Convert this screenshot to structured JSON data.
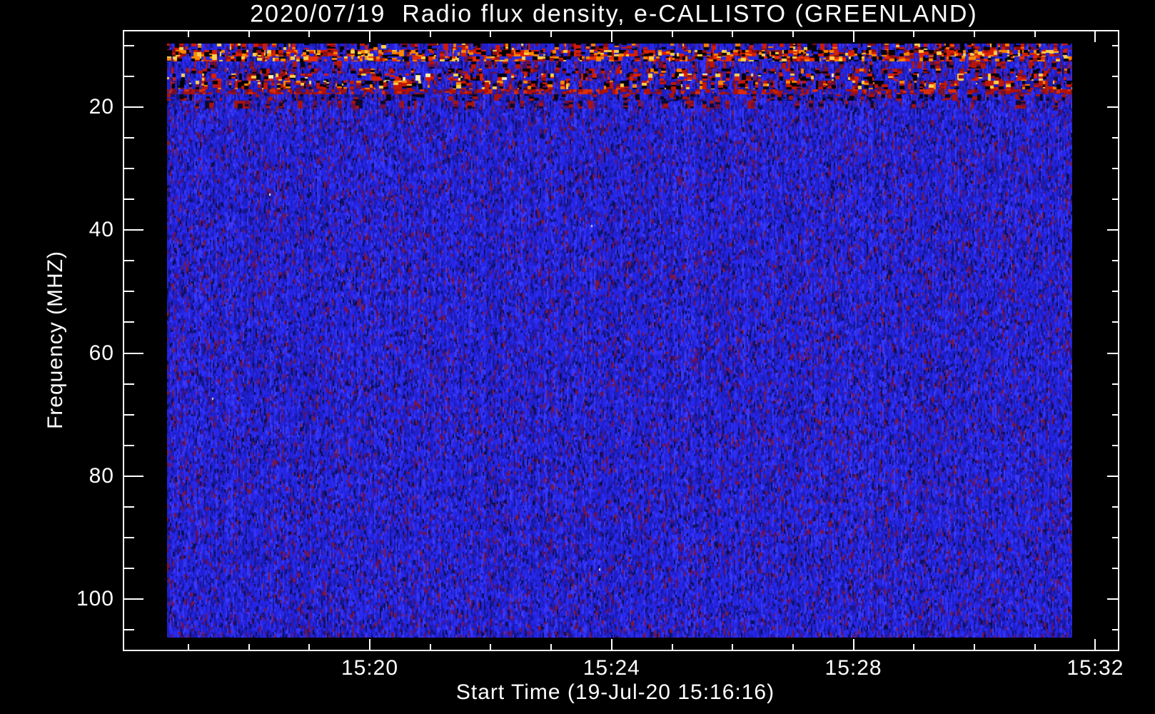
{
  "title": "2020/07/19  Radio flux density, e-CALLISTO (GREENLAND)",
  "x_axis": {
    "label": "Start Time (19-Jul-20 15:16:16)",
    "tick_labels": [
      "15:20",
      "15:24",
      "15:28",
      "15:32"
    ]
  },
  "y_axis": {
    "label": "Frequency (MHZ)",
    "tick_labels": [
      "20",
      "40",
      "60",
      "80",
      "100"
    ]
  },
  "chart_data": {
    "type": "heatmap",
    "subtype": "radio-spectrogram",
    "title": "2020/07/19  Radio flux density, e-CALLISTO (GREENLAND)",
    "xlabel": "Start Time (19-Jul-20 15:16:16)",
    "ylabel": "Frequency (MHZ)",
    "x_start_time": "15:16:16",
    "x_tick_labels": [
      "15:20",
      "15:24",
      "15:28",
      "15:32"
    ],
    "x_major_interval_min": 4,
    "x_minor_interval_min": 1,
    "y_tick_values_mhz": [
      20,
      40,
      60,
      80,
      100
    ],
    "y_minor_tick_values_mhz": [
      10,
      15,
      25,
      30,
      35,
      45,
      50,
      55,
      65,
      70,
      75,
      85,
      90,
      95,
      105
    ],
    "y_axis_inverted": true,
    "data_freq_range_mhz": [
      9.6,
      106.3
    ],
    "background_color": "#000000",
    "axis_color": "#ffffff",
    "noise": {
      "base_blue_colors": [
        "#0d0d50",
        "#16168e",
        "#1e1ec2",
        "#2525e2",
        "#2e2ef2",
        "#3a3af8"
      ],
      "speck_colors": [
        "#5f1166",
        "#75124d",
        "#43106e",
        "#801a36"
      ],
      "speck_probability": 0.11
    },
    "rfi_bands": [
      {
        "f0": 9.6,
        "f1": 10.7,
        "density": 0.5,
        "palette": [
          [
            "#cf1a08",
            0.3
          ],
          [
            "#8b0a12",
            0.15
          ],
          [
            "#000008",
            0.2
          ],
          [
            "#ff7b00",
            0.08
          ],
          [
            "#ffd24a",
            0.05
          ],
          [
            "#2121cf",
            0.22
          ]
        ]
      },
      {
        "f0": 10.7,
        "f1": 11.7,
        "density": 0.88,
        "palette": [
          [
            "#d81f05",
            0.26
          ],
          [
            "#000005",
            0.24
          ],
          [
            "#ff8800",
            0.14
          ],
          [
            "#ffd24a",
            0.1
          ],
          [
            "#8d0f15",
            0.12
          ],
          [
            "#2323d8",
            0.14
          ]
        ]
      },
      {
        "f0": 11.7,
        "f1": 12.6,
        "density": 0.82,
        "palette": [
          [
            "#ff8800",
            0.16
          ],
          [
            "#ffd24a",
            0.12
          ],
          [
            "#e62e05",
            0.2
          ],
          [
            "#9c1212",
            0.14
          ],
          [
            "#00000a",
            0.18
          ],
          [
            "#2a2ae0",
            0.2
          ]
        ]
      },
      {
        "f0": 12.6,
        "f1": 13.7,
        "density": 0.22,
        "palette": [
          [
            "#b5160a",
            0.5
          ],
          [
            "#6f0f3a",
            0.25
          ],
          [
            "#05051a",
            0.25
          ]
        ]
      },
      {
        "f0": 13.7,
        "f1": 14.5,
        "density": 0.5,
        "palette": [
          [
            "#c21708",
            0.3
          ],
          [
            "#00000a",
            0.3
          ],
          [
            "#7c0f28",
            0.18
          ],
          [
            "#ff7b00",
            0.06
          ],
          [
            "#2121cf",
            0.16
          ]
        ]
      },
      {
        "f0": 14.5,
        "f1": 15.7,
        "density": 0.55,
        "palette": [
          [
            "#d81f05",
            0.3
          ],
          [
            "#ffd24a",
            0.07
          ],
          [
            "#fff3b0",
            0.03
          ],
          [
            "#00000a",
            0.22
          ],
          [
            "#8d0f15",
            0.14
          ],
          [
            "#2525da",
            0.24
          ]
        ]
      },
      {
        "f0": 15.7,
        "f1": 17.1,
        "density": 0.62,
        "palette": [
          [
            "#000008",
            0.3
          ],
          [
            "#c21708",
            0.24
          ],
          [
            "#ff8800",
            0.1
          ],
          [
            "#ffd24a",
            0.05
          ],
          [
            "#6f0f3a",
            0.12
          ],
          [
            "#1a1ab0",
            0.19
          ]
        ]
      },
      {
        "f0": 17.1,
        "f1": 17.9,
        "density": 0.8,
        "palette": [
          [
            "#b01205",
            0.42
          ],
          [
            "#d8300a",
            0.18
          ],
          [
            "#701030",
            0.16
          ],
          [
            "#1d1dc4",
            0.24
          ]
        ]
      },
      {
        "f0": 17.9,
        "f1": 18.9,
        "density": 0.42,
        "palette": [
          [
            "#05051c",
            0.34
          ],
          [
            "#14147a",
            0.2
          ],
          [
            "#a8130f",
            0.22
          ],
          [
            "#2020c8",
            0.24
          ]
        ]
      },
      {
        "f0": 18.9,
        "f1": 20.2,
        "density": 0.22,
        "palette": [
          [
            "#a8130f",
            0.4
          ],
          [
            "#6f0f3a",
            0.3
          ],
          [
            "#0a0a30",
            0.3
          ]
        ]
      }
    ]
  }
}
